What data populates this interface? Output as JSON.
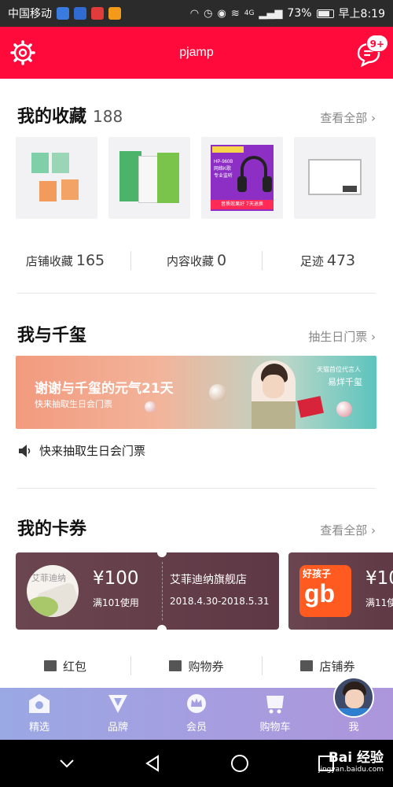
{
  "status_bar": {
    "carrier": "中国移动",
    "battery": "73%",
    "time": "早上8:19",
    "network": "4G"
  },
  "header": {
    "title": "pjamp",
    "message_badge": "9+"
  },
  "favorites": {
    "title": "我的收藏",
    "count": "188",
    "more": "查看全部",
    "thumb_text": [
      "HP-960B",
      "网络K歌",
      "专业监听",
      "音质效果好 7天退换"
    ]
  },
  "stats": [
    {
      "label": "店铺收藏",
      "value": "165"
    },
    {
      "label": "内容收藏",
      "value": "0"
    },
    {
      "label": "足迹",
      "value": "473"
    }
  ],
  "celebrity": {
    "title": "我与千玺",
    "more": "抽生日门票",
    "banner_title": "谢谢与千玺的元气21天",
    "banner_sub": "快来抽取生日会门票",
    "banner_tag_small": "天猫首位代言人",
    "banner_tag": "易烊千玺",
    "notice": "快来抽取生日会门票"
  },
  "coupons": {
    "title": "我的卡券",
    "more": "查看全部",
    "items": [
      {
        "logo_text": "艾菲迪纳",
        "amount": "¥100",
        "condition": "满101使用",
        "shop": "艾菲迪纳旗舰店",
        "date": "2018.4.30-2018.5.31"
      },
      {
        "logo_text_top": "好孩子",
        "logo_text": "gb",
        "amount": "¥10",
        "condition": "满11使"
      }
    ]
  },
  "coupon_tabs": [
    "红包",
    "购物券",
    "店铺券"
  ],
  "tabbar": [
    "精选",
    "品牌",
    "会员",
    "购物车",
    "我"
  ],
  "watermark": {
    "brand": "Bai 经验",
    "url": "jingyan.baidu.com"
  },
  "colors": {
    "primary": "#ff0a3b",
    "tabbar": "#a59ee0",
    "coupon": "#5e3844"
  }
}
